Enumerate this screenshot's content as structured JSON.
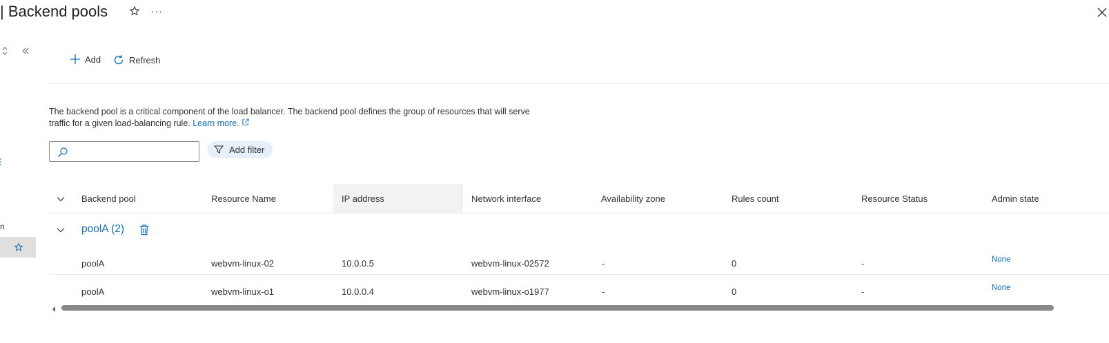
{
  "header": {
    "title": "| Backend pools",
    "favorite_icon": "star-outline-icon",
    "more_label": "···",
    "close_icon": "close-icon"
  },
  "leftnav": {
    "partial_label": "n",
    "selected_item_icon": "star-icon",
    "expand_icon": "sort-icon",
    "collapse_icon": "double-chevron-left-icon"
  },
  "toolbar": {
    "add_label": "Add",
    "refresh_label": "Refresh"
  },
  "description": {
    "text": "The backend pool is a critical component of the load balancer. The backend pool defines the group of resources that will serve traffic for a given load-balancing rule.",
    "link_text": "Learn more."
  },
  "search": {
    "placeholder": "",
    "value": ""
  },
  "filter": {
    "label": "Add filter"
  },
  "table": {
    "columns": [
      "Backend pool",
      "Resource Name",
      "IP address",
      "Network interface",
      "Availability zone",
      "Rules count",
      "Resource Status",
      "Admin state"
    ],
    "groups": [
      {
        "label": "poolA (2)",
        "rows": [
          {
            "backend_pool": "poolA",
            "resource_name": "webvm-linux-02",
            "ip": "10.0.0.5",
            "nic": "webvm-linux-02572",
            "zone": "-",
            "rules": "0",
            "status": "-",
            "admin": "None"
          },
          {
            "backend_pool": "poolA",
            "resource_name": "webvm-linux-o1",
            "ip": "10.0.0.4",
            "nic": "webvm-linux-o1977",
            "zone": "-",
            "rules": "0",
            "status": "-",
            "admin": "None"
          }
        ]
      }
    ]
  },
  "colors": {
    "accent": "#0f6cbd",
    "text": "#323130",
    "scrollbar": "#8a8886"
  }
}
